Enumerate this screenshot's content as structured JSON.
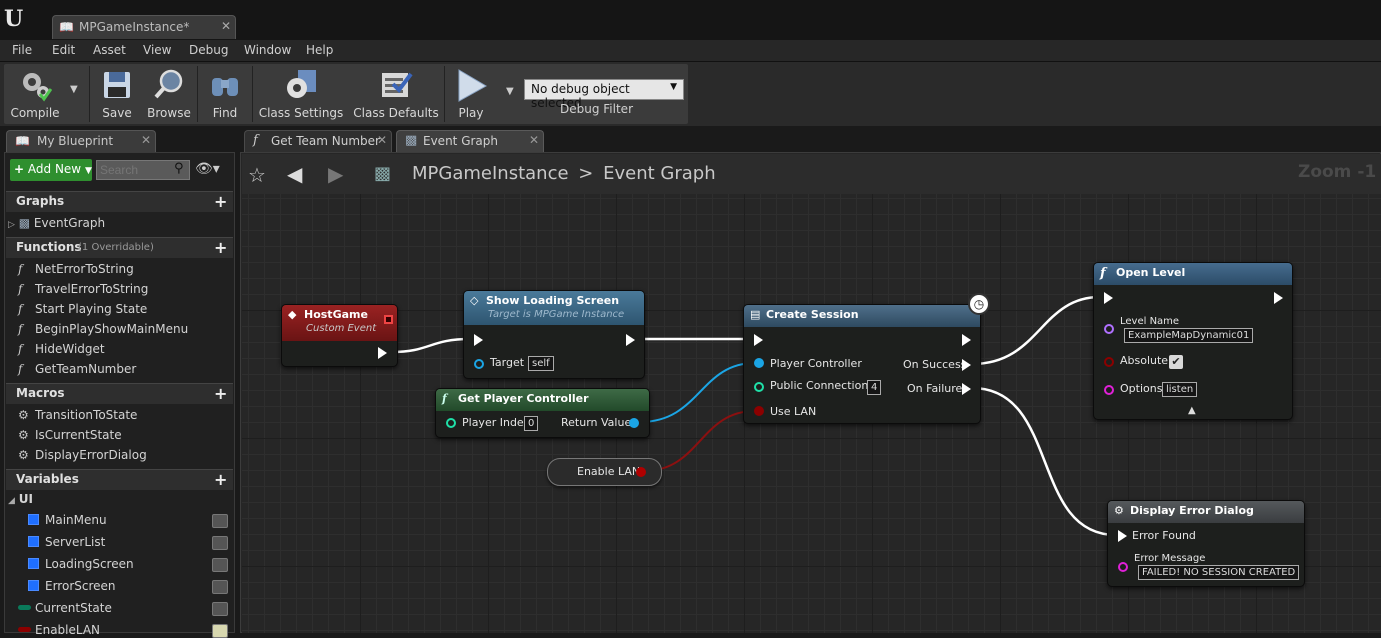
{
  "window": {
    "doc_tab_label": "MPGameInstance*",
    "logo": "U"
  },
  "menu": [
    "File",
    "Edit",
    "Asset",
    "View",
    "Debug",
    "Window",
    "Help"
  ],
  "toolbar": {
    "compile": "Compile",
    "save": "Save",
    "browse": "Browse",
    "find": "Find",
    "class_settings": "Class Settings",
    "class_defaults": "Class Defaults",
    "play": "Play",
    "debug_object": "No debug object selected",
    "debug_filter": "Debug Filter"
  },
  "my_blueprint": {
    "tab_label": "My Blueprint",
    "add_new": "Add New",
    "search_placeholder": "Search",
    "graphs_header": "Graphs",
    "graphs": [
      "EventGraph"
    ],
    "functions_header": "Functions",
    "functions_sub": "(1 Overridable)",
    "functions": [
      "NetErrorToString",
      "TravelErrorToString",
      "Start Playing State",
      "BeginPlayShowMainMenu",
      "HideWidget",
      "GetTeamNumber"
    ],
    "macros_header": "Macros",
    "macros": [
      "TransitionToState",
      "IsCurrentState",
      "DisplayErrorDialog"
    ],
    "variables_header": "Variables",
    "var_category": "UI",
    "ui_variables": [
      "MainMenu",
      "ServerList",
      "LoadingScreen",
      "ErrorScreen"
    ],
    "other_variables": [
      "CurrentState",
      "EnableLAN"
    ]
  },
  "editor_tabs": [
    "Get Team Number",
    "Event Graph"
  ],
  "breadcrumb": {
    "root": "MPGameInstance",
    "sep": ">",
    "current": "Event Graph",
    "zoom": "Zoom -1"
  },
  "nodes": {
    "host_game": {
      "title": "HostGame",
      "subtitle": "Custom Event"
    },
    "show_loading": {
      "title": "Show Loading Screen",
      "subtitle": "Target is MPGame Instance",
      "target_label": "Target",
      "target_value": "self"
    },
    "get_pc": {
      "title": "Get Player Controller",
      "index_label": "Player Index",
      "index_value": "0",
      "return_label": "Return Value"
    },
    "enable_lan": {
      "label": "Enable LAN"
    },
    "create_session": {
      "title": "Create Session",
      "player_controller": "Player Controller",
      "public_connections": "Public Connections",
      "public_connections_value": "4",
      "use_lan": "Use LAN",
      "on_success": "On Success",
      "on_failure": "On Failure"
    },
    "open_level": {
      "title": "Open Level",
      "level_name_label": "Level Name",
      "level_name_value": "ExampleMapDynamic01",
      "absolute_label": "Absolute",
      "absolute_checked": true,
      "options_label": "Options",
      "options_value": "listen"
    },
    "display_error": {
      "title": "Display Error Dialog",
      "error_found": "Error Found",
      "error_message_label": "Error Message",
      "error_message_value": "FAILED! NO SESSION CREATED"
    }
  },
  "colors": {
    "event_header": "#8a1c1c",
    "function_header": "#3f6a8a",
    "pure_header": "#2e5a3a",
    "object_pin": "#1ba5e5",
    "bool_pin": "#8c0000",
    "int_pin": "#1fe0a8",
    "string_pin": "#e020d8",
    "name_pin": "#b070ff",
    "add_new": "#2f8f2f"
  }
}
